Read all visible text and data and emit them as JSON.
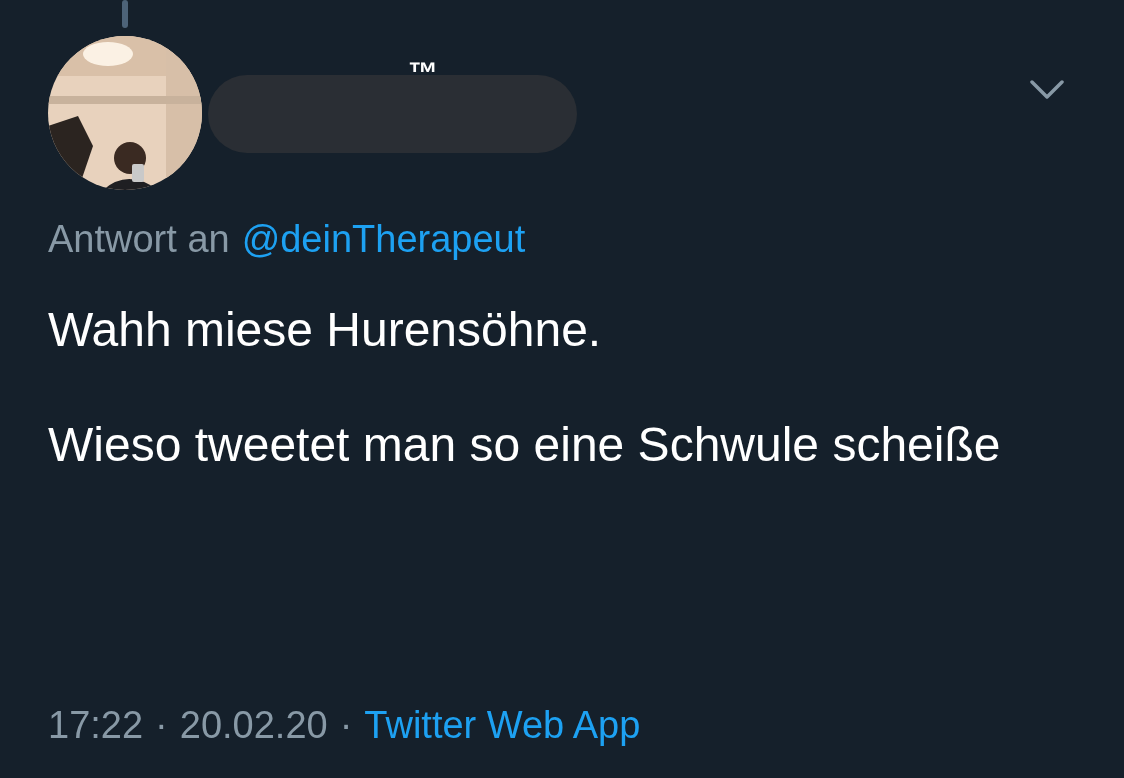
{
  "author": {
    "name_visible": "™"
  },
  "reply_to": {
    "prefix": "Antwort an",
    "handle": "@deinTherapeut"
  },
  "tweet": {
    "paragraphs": [
      "Wahh miese Hurensöhne.",
      "Wieso tweetet man so eine Schwule scheiße"
    ]
  },
  "meta": {
    "time": "17:22",
    "separator_1": "·",
    "date": "20.02.20",
    "separator_2": "·",
    "source": "Twitter Web App"
  }
}
